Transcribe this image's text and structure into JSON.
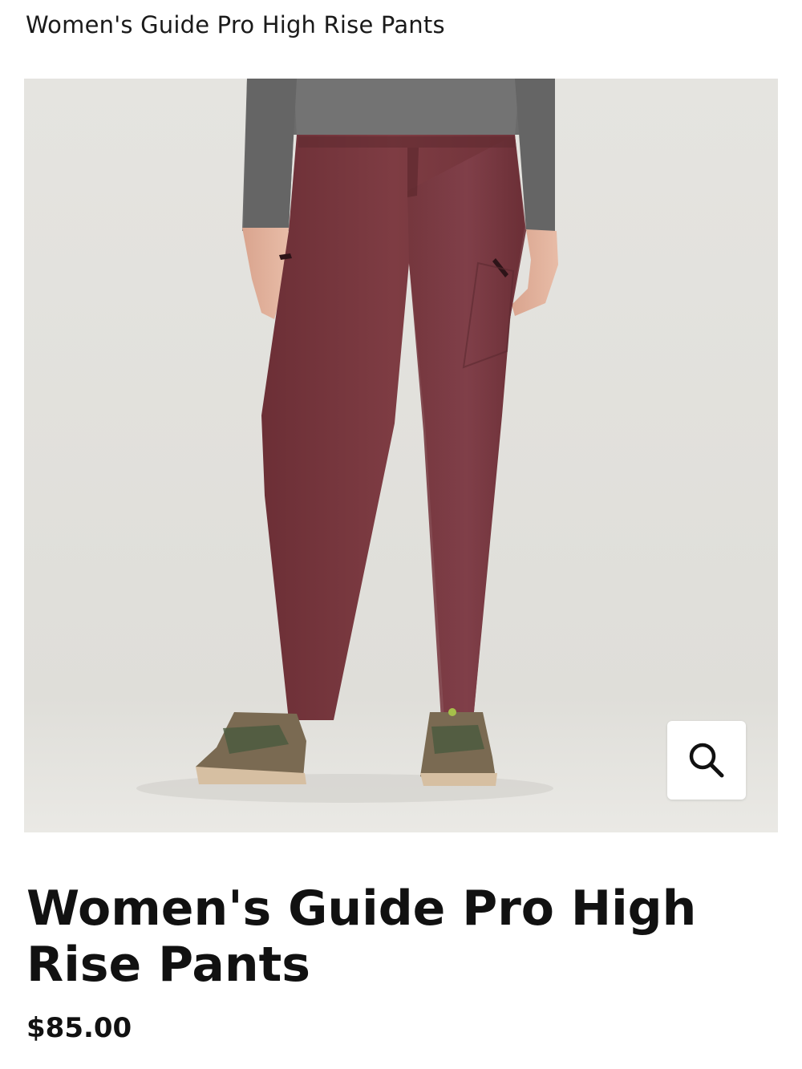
{
  "header": {
    "title": "Women's Guide Pro High Rise Pants"
  },
  "gallery": {
    "image_subject": "product-photo-pants",
    "zoom_icon": "search-icon",
    "slide_count": 2,
    "active_slide": 1
  },
  "product": {
    "name": "Women's Guide Pro High Rise Pants",
    "price": "$85.00"
  },
  "colors": {
    "pants": "#7a3a40",
    "background": "#e4e3df",
    "sweater": "#6b6b6b"
  }
}
